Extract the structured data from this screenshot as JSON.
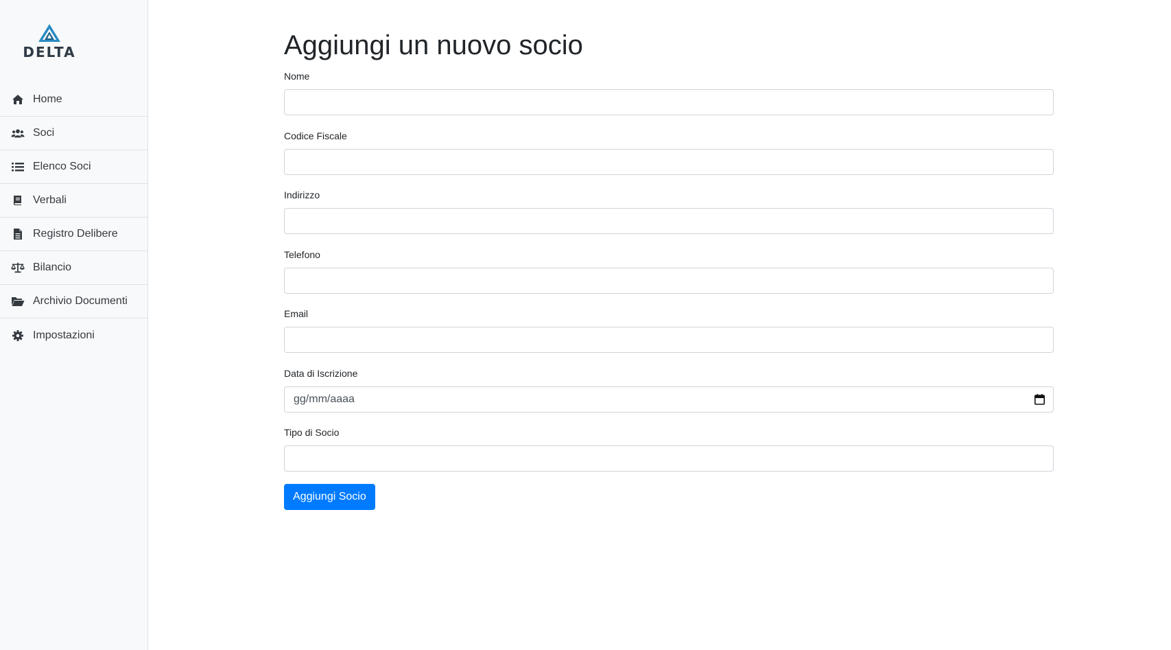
{
  "brand": {
    "name": "DELTA",
    "accent_color": "#2a8cc4",
    "dark_color": "#1f5f86"
  },
  "sidebar": {
    "items": [
      {
        "label": "Home",
        "icon": "home-icon"
      },
      {
        "label": "Soci",
        "icon": "users-icon"
      },
      {
        "label": "Elenco Soci",
        "icon": "list-icon"
      },
      {
        "label": "Verbali",
        "icon": "book-icon"
      },
      {
        "label": "Registro Delibere",
        "icon": "file-icon"
      },
      {
        "label": "Bilancio",
        "icon": "scale-icon"
      },
      {
        "label": "Archivio Documenti",
        "icon": "folder-open-icon"
      },
      {
        "label": "Impostazioni",
        "icon": "gear-icon"
      }
    ]
  },
  "main": {
    "title": "Aggiungi un nuovo socio",
    "form": {
      "nome": {
        "label": "Nome",
        "value": ""
      },
      "codice_fiscale": {
        "label": "Codice Fiscale",
        "value": ""
      },
      "indirizzo": {
        "label": "Indirizzo",
        "value": ""
      },
      "telefono": {
        "label": "Telefono",
        "value": ""
      },
      "email": {
        "label": "Email",
        "value": ""
      },
      "data_iscrizione": {
        "label": "Data di Iscrizione",
        "placeholder": "gg/mm/aaaa",
        "icon": "calendar-icon"
      },
      "tipo_socio": {
        "label": "Tipo di Socio",
        "value": ""
      },
      "submit_label": "Aggiungi Socio"
    }
  },
  "colors": {
    "primary_button": "#007bff",
    "sidebar_bg": "#f8f9fa",
    "border": "#dee2e6"
  }
}
